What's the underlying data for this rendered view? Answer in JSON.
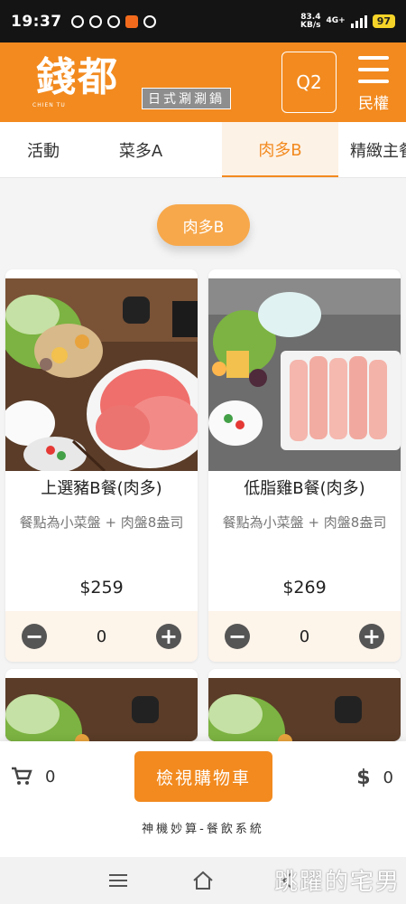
{
  "status_bar": {
    "time": "19:37",
    "net_speed_top": "83.4",
    "net_speed_bottom": "KB/s",
    "network": "4G+",
    "battery": "97"
  },
  "header": {
    "logo_text": "錢都",
    "logo_sub": "CHIEN TU",
    "logo_tag": "日式涮涮鍋",
    "table_label": "Q2",
    "menu_label": "民權"
  },
  "tabs": [
    {
      "label": "活動",
      "active": false
    },
    {
      "label": "菜多A",
      "active": false
    },
    {
      "label": "肉多B",
      "active": true
    },
    {
      "label": "精緻主餐",
      "active": false
    }
  ],
  "category_pill": "肉多B",
  "products": [
    {
      "name": "上選豬B餐(肉多)",
      "desc": "餐點為小菜盤 + 肉盤8盎司",
      "price": "$259",
      "qty": "0",
      "minus": "−",
      "plus": "+"
    },
    {
      "name": "低脂雞B餐(肉多)",
      "desc": "餐點為小菜盤 + 肉盤8盎司",
      "price": "$269",
      "qty": "0",
      "minus": "−",
      "plus": "+"
    }
  ],
  "bottom": {
    "cart_count": "0",
    "view_cart_label": "檢視購物車",
    "total": "0",
    "dollar_sign": "$",
    "brand": "神機妙算-餐飲系統"
  },
  "watermark": "跳躍的宅男",
  "colors": {
    "brand_orange": "#f28a1f",
    "pill_orange": "#f7a84b",
    "qty_bg": "#fdf4ea"
  }
}
